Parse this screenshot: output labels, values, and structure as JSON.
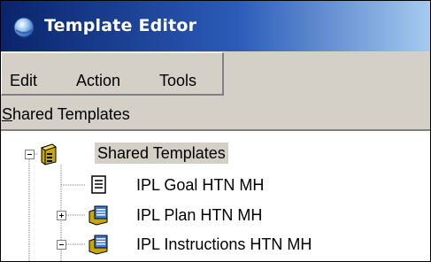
{
  "window": {
    "title": "Template Editor",
    "icon": "globe-icon"
  },
  "menubar": {
    "items": [
      {
        "label": "Edit"
      },
      {
        "label": "Action"
      },
      {
        "label": "Tools"
      }
    ]
  },
  "panel": {
    "label_first": "S",
    "label_rest": "hared Templates"
  },
  "tree": {
    "root": {
      "label": "Shared Templates",
      "icon": "shared-templates-folder-icon",
      "expanded": true,
      "selected": true
    },
    "children": [
      {
        "label": "IPL Goal HTN MH",
        "icon": "document-icon",
        "expander": "none"
      },
      {
        "label": "IPL Plan HTN MH",
        "icon": "template-book-icon",
        "expander": "collapsed"
      },
      {
        "label": "IPL Instructions HTN MH",
        "icon": "template-book-icon",
        "expander": "expanded"
      }
    ]
  },
  "colors": {
    "titlebar_start": "#0a246a",
    "titlebar_end": "#a6caf0",
    "chrome": "#d4d0c8"
  }
}
